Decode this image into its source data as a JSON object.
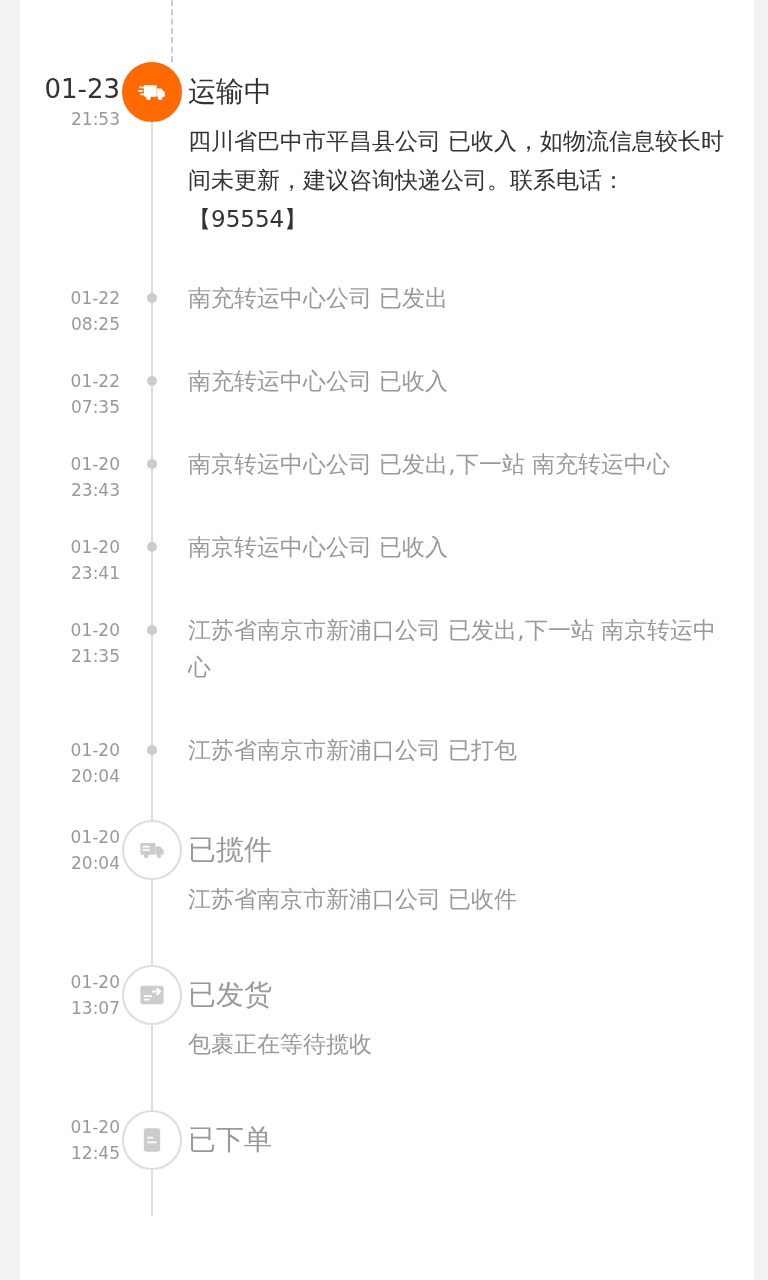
{
  "entries": [
    {
      "kind": "transit",
      "current": true,
      "date": "01-23",
      "time": "21:53",
      "title": "运输中",
      "description": "四川省巴中市平昌县公司 已收入，如物流信息较长时间未更新，建议咨询快递公司。联系电话：【95554】"
    },
    {
      "kind": "update",
      "current": false,
      "date": "01-22",
      "time": "08:25",
      "description": "南充转运中心公司 已发出"
    },
    {
      "kind": "update",
      "current": false,
      "date": "01-22",
      "time": "07:35",
      "description": "南充转运中心公司 已收入"
    },
    {
      "kind": "update",
      "current": false,
      "date": "01-20",
      "time": "23:43",
      "description": "南京转运中心公司 已发出,下一站 南充转运中心"
    },
    {
      "kind": "update",
      "current": false,
      "date": "01-20",
      "time": "23:41",
      "description": "南京转运中心公司 已收入"
    },
    {
      "kind": "update",
      "current": false,
      "date": "01-20",
      "time": "21:35",
      "description": "江苏省南京市新浦口公司 已发出,下一站 南京转运中心"
    },
    {
      "kind": "update",
      "current": false,
      "date": "01-20",
      "time": "20:04",
      "description": "江苏省南京市新浦口公司 已打包"
    },
    {
      "kind": "pickup",
      "current": false,
      "date": "01-20",
      "time": "20:04",
      "title": "已揽件",
      "description": "江苏省南京市新浦口公司 已收件"
    },
    {
      "kind": "shipped",
      "current": false,
      "date": "01-20",
      "time": "13:07",
      "title": "已发货",
      "description": "包裹正在等待揽收"
    },
    {
      "kind": "ordered",
      "current": false,
      "date": "01-20",
      "time": "12:45",
      "title": "已下单"
    }
  ]
}
